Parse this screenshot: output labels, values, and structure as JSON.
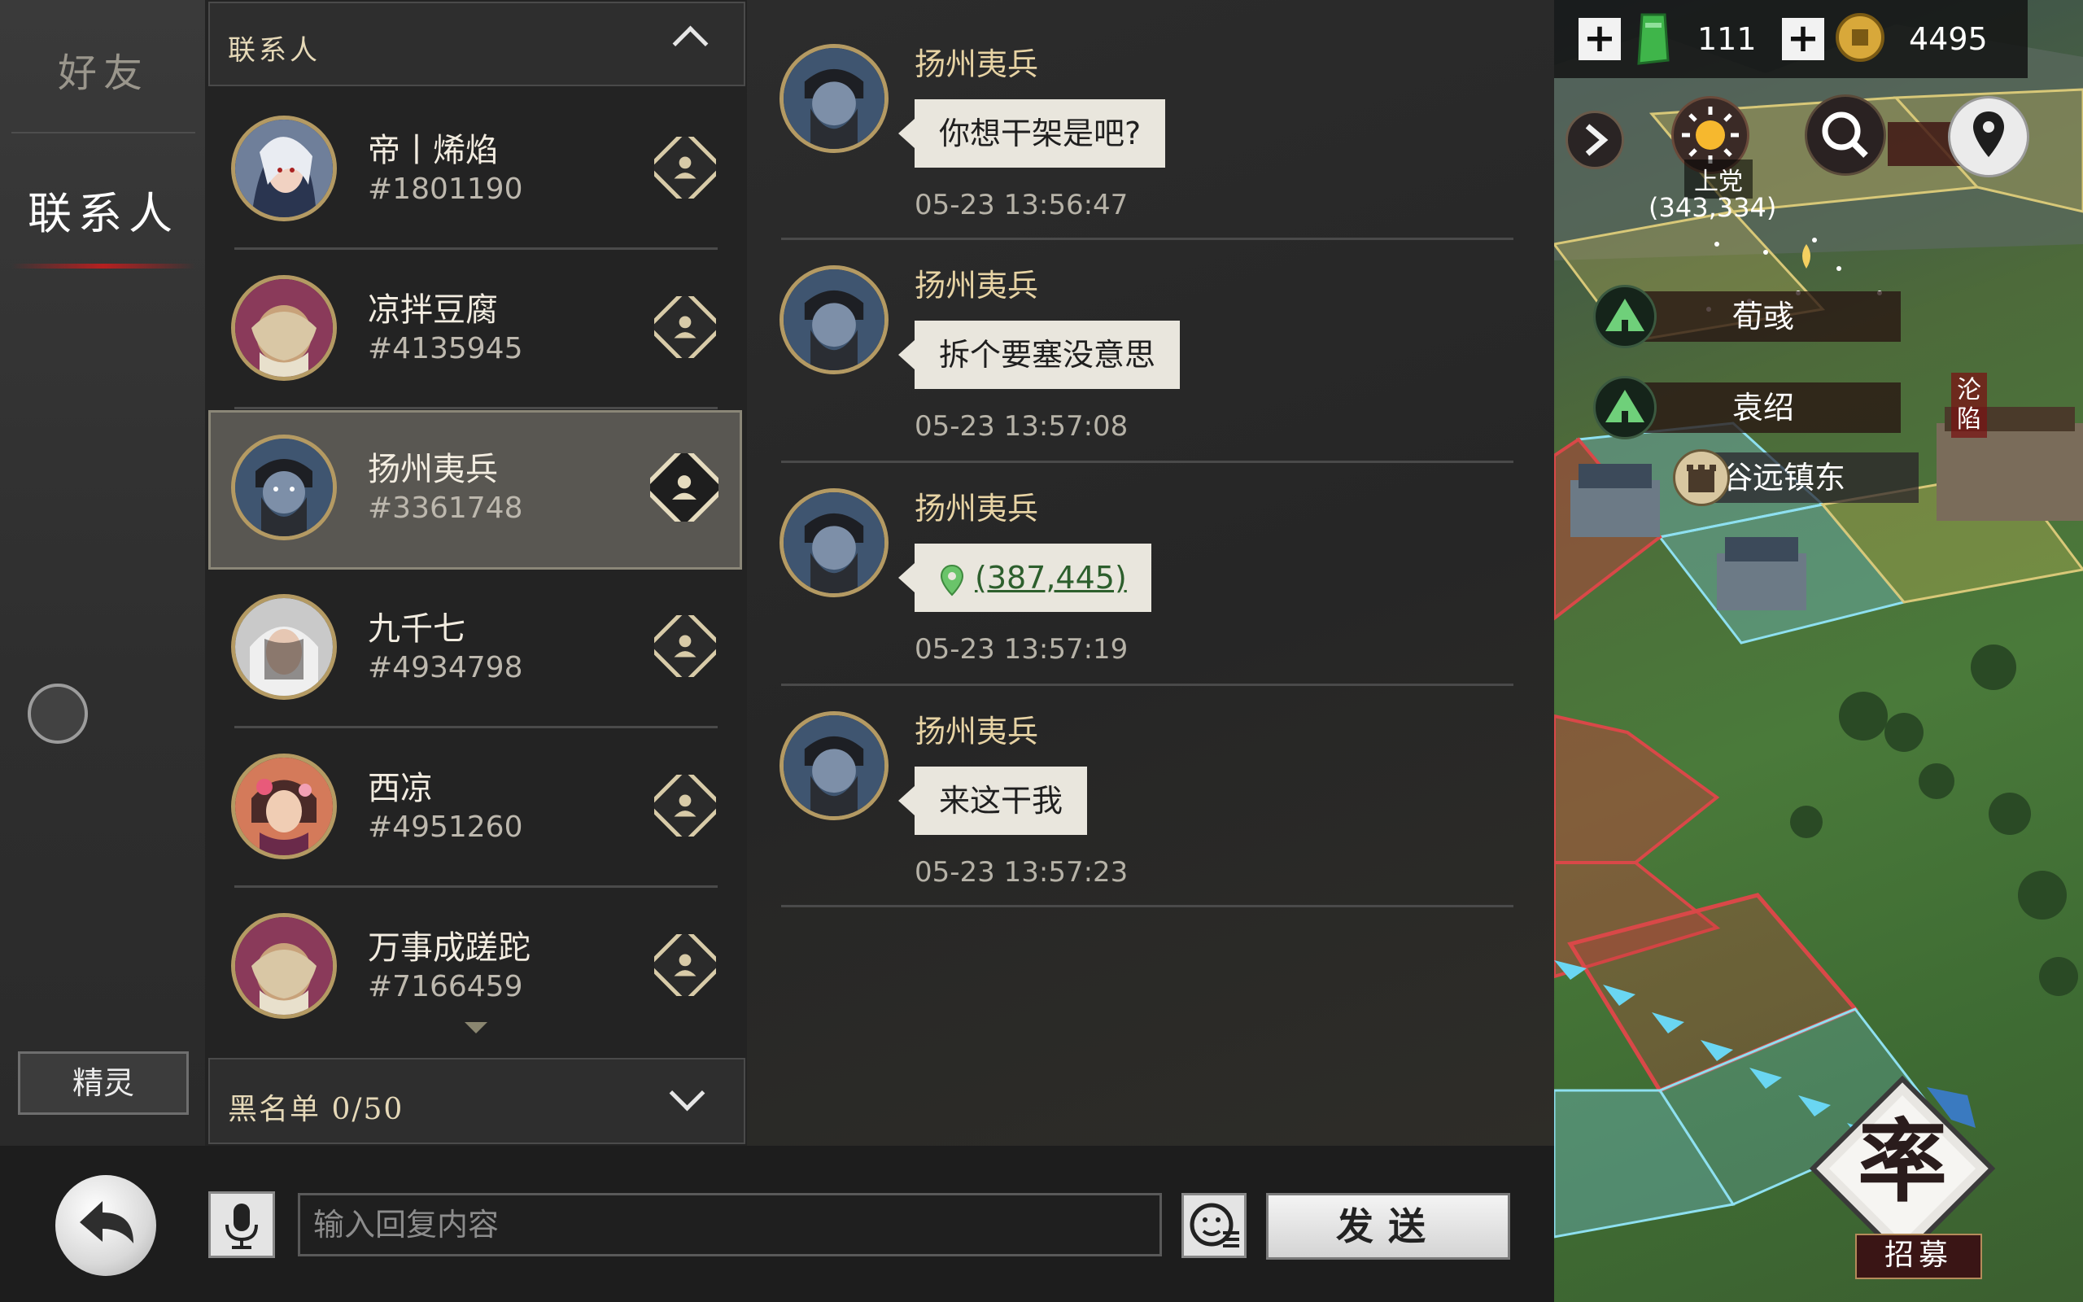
{
  "sidebar": {
    "tab_friends": "好友",
    "tab_contacts": "联系人",
    "spirit_button": "精灵"
  },
  "contacts": {
    "header_title": "联系人",
    "items": [
      {
        "name": "帝丨烯焰",
        "id": "#1801190",
        "avatar_icon": "hero-portrait-icon"
      },
      {
        "name": "凉拌豆腐",
        "id": "#4135945",
        "avatar_icon": "hero-portrait-icon"
      },
      {
        "name": "扬州夷兵",
        "id": "#3361748",
        "avatar_icon": "hero-portrait-icon",
        "selected": true
      },
      {
        "name": "九千七",
        "id": "#4934798",
        "avatar_icon": "hero-portrait-icon"
      },
      {
        "name": "西凉",
        "id": "#4951260",
        "avatar_icon": "hero-portrait-icon"
      },
      {
        "name": "万事成蹉跎",
        "id": "#7166459",
        "avatar_icon": "hero-portrait-icon"
      }
    ],
    "blacklist_label": "黑名单 0/50"
  },
  "chat": {
    "messages": [
      {
        "sender": "扬州夷兵",
        "text": "你想干架是吧?",
        "time": "05-23 13:56:47"
      },
      {
        "sender": "扬州夷兵",
        "text": "拆个要塞没意思",
        "time": "05-23 13:57:08"
      },
      {
        "sender": "扬州夷兵",
        "text": "(387,445)",
        "time": "05-23 13:57:19",
        "is_coordinate": true
      },
      {
        "sender": "扬州夷兵",
        "text": "来这干我",
        "time": "05-23 13:57:23"
      }
    ]
  },
  "input": {
    "placeholder": "输入回复内容",
    "send_label": "发送"
  },
  "map": {
    "jade_amount": "111",
    "copper_amount": "4495",
    "city_name": "上党",
    "coordinates": "(343,334)",
    "labels": {
      "xun_yu": "荀彧",
      "yuan_shao": "袁绍",
      "guyuan_east": "谷远镇东",
      "fallen": "沦陷"
    },
    "recruit_label": "招募",
    "recruit_glyph": "率"
  },
  "colors": {
    "accent_red": "#b52020",
    "gold": "#b49a63",
    "bubble": "#e9e6dd",
    "link_green": "#2d5f2d"
  }
}
